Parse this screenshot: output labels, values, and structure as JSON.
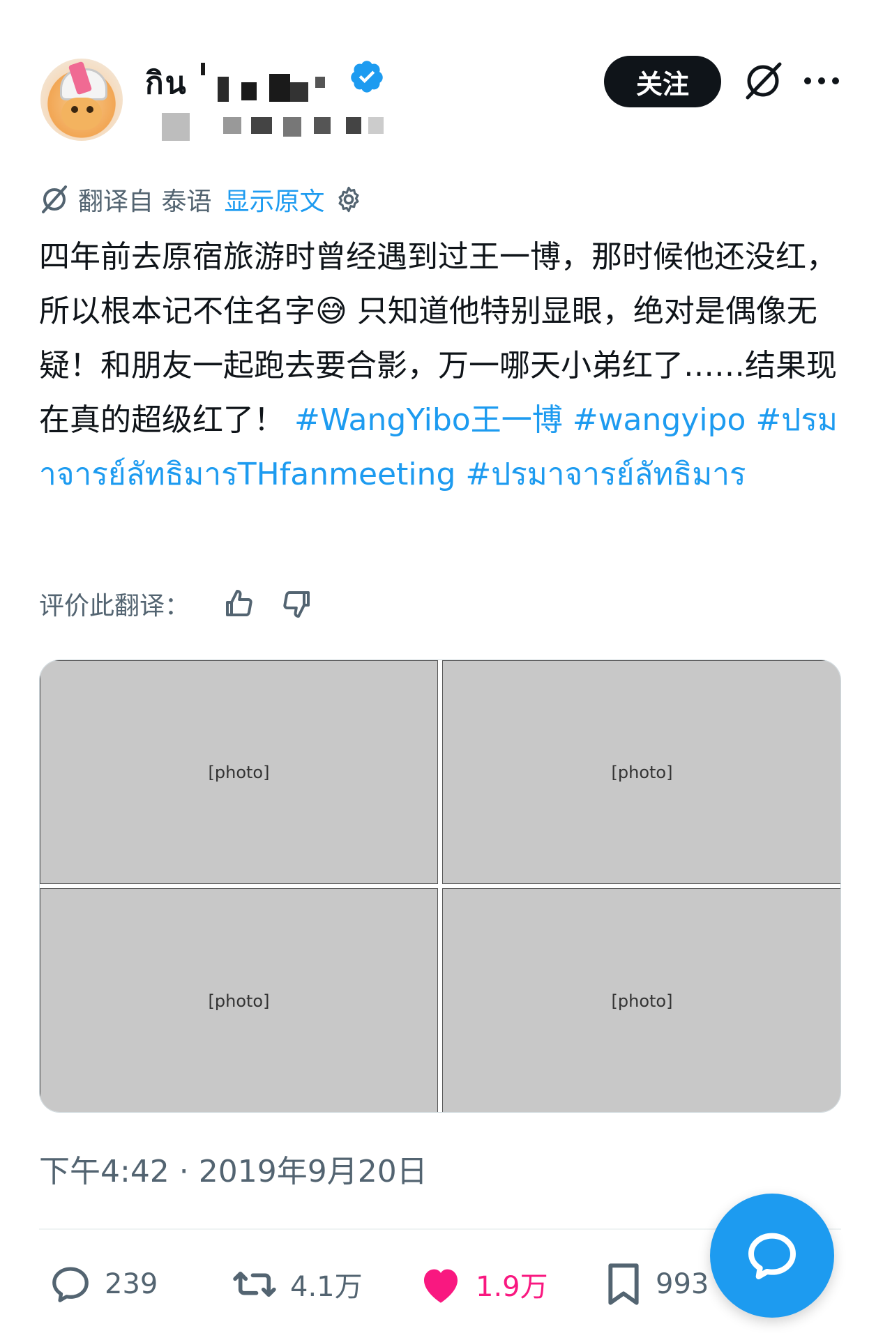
{
  "author": {
    "display_name": "กิน",
    "handle": ""
  },
  "header": {
    "follow_label": "关注"
  },
  "translation": {
    "label": "翻译自 泰语",
    "show_original": "显示原文"
  },
  "tweet": {
    "text": "四年前去原宿旅游时曾经遇到过王一博，那时候他还没红，所以根本记不住名字😅 只知道他特别显眼，绝对是偶像无疑！和朋友一起跑去要合影，万一哪天小弟红了……结果现在真的超级红了！ ",
    "hashtags": "#WangYibo王一博 #wangyipo #ปรมาจารย์ลัทธิมารTHfanmeeting #ปรมาจารย์ลัทธิมาร"
  },
  "rate": {
    "label": "评价此翻译："
  },
  "timestamp": "下午4:42 · 2019年9月20日",
  "stats": {
    "replies": "239",
    "retweets": "4.1万",
    "likes": "1.9万",
    "bookmarks": "993"
  },
  "colors": {
    "accent": "#1d9bf0",
    "like": "#f91880",
    "text_primary": "#0f1419",
    "text_secondary": "#536471"
  }
}
